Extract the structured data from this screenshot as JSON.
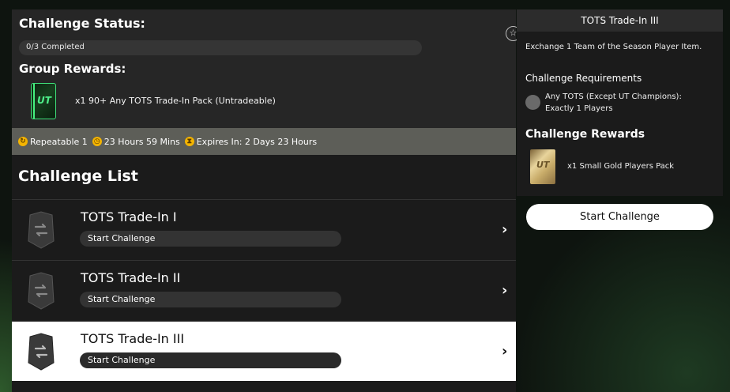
{
  "status": {
    "title": "Challenge Status:",
    "progress_text": "0/3 Completed",
    "progress_fraction": 0,
    "group_rewards_title": "Group Rewards:",
    "group_reward_item": "x1 90+ Any TOTS Trade-In Pack (Untradeable)",
    "group_reward_pack_label": "UT"
  },
  "meta": {
    "repeatable": "Repeatable 1",
    "time_left": "23 Hours 59 Mins",
    "expires": "Expires In: 2 Days 23 Hours"
  },
  "list": {
    "title": "Challenge List",
    "items": [
      {
        "title": "TOTS Trade-In I",
        "pill": "Start Challenge"
      },
      {
        "title": "TOTS Trade-In II",
        "pill": "Start Challenge"
      },
      {
        "title": "TOTS Trade-In III",
        "pill": "Start Challenge"
      }
    ]
  },
  "detail": {
    "title": "TOTS Trade-In III",
    "description": "Exchange 1 Team of the Season Player Item.",
    "requirements_title": "Challenge Requirements",
    "requirement_line1": "Any TOTS (Except UT Champions):",
    "requirement_line2": "Exactly 1 Players",
    "rewards_title": "Challenge Rewards",
    "reward_item": "x1 Small Gold Players Pack",
    "reward_pack_label": "UT",
    "start_button": "Start Challenge"
  },
  "icons": {
    "star": "star-icon",
    "repeat": "repeat-icon",
    "clock": "clock-icon",
    "expires": "hourglass-icon",
    "chevron": "chevron-right-icon",
    "challenge_badge": "shield-swap-icon"
  },
  "colors": {
    "panel": "#1b1b1b",
    "status_panel": "#262626",
    "meta_bar": "#5d5e58",
    "accent_gold": "#f4b400",
    "selected_row": "#ffffff",
    "pack_green": "#46f07f"
  }
}
